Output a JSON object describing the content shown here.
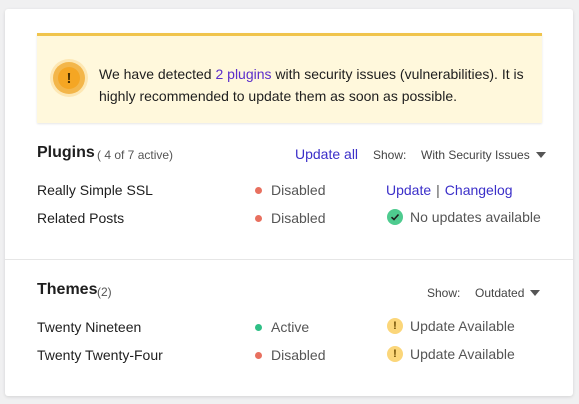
{
  "notice": {
    "text_before": "We have detected ",
    "link": "2 plugins",
    "text_after": " with security issues (vulnerabilities). It is highly recommended to update them as soon as possible.",
    "icon": "exclamation-icon"
  },
  "plugins": {
    "title": "Plugins",
    "subtitle": "( 4 of 7 active)",
    "update_all": "Update all",
    "show_label": "Show:",
    "filter": "With Security Issues",
    "rows": [
      {
        "name": "Really Simple SSL",
        "status": "Disabled",
        "status_color": "#e8705f",
        "action_update": "Update",
        "action_sep": "|",
        "action_changelog": "Changelog"
      },
      {
        "name": "Related Posts",
        "status": "Disabled",
        "status_color": "#e8705f",
        "action_text": "No updates available"
      }
    ]
  },
  "themes": {
    "title": "Themes",
    "subtitle": "(2)",
    "show_label": "Show:",
    "filter": "Outdated",
    "rows": [
      {
        "name": "Twenty Nineteen",
        "status": "Active",
        "status_color": "#2fbf86",
        "action_text": "Update Available"
      },
      {
        "name": "Twenty Twenty-Four",
        "status": "Disabled",
        "status_color": "#e8705f",
        "action_text": "Update Available"
      }
    ]
  },
  "colors": {
    "link": "#3b2fc9",
    "notice_bg": "#fff8dc",
    "notice_border": "#f0c44c"
  }
}
